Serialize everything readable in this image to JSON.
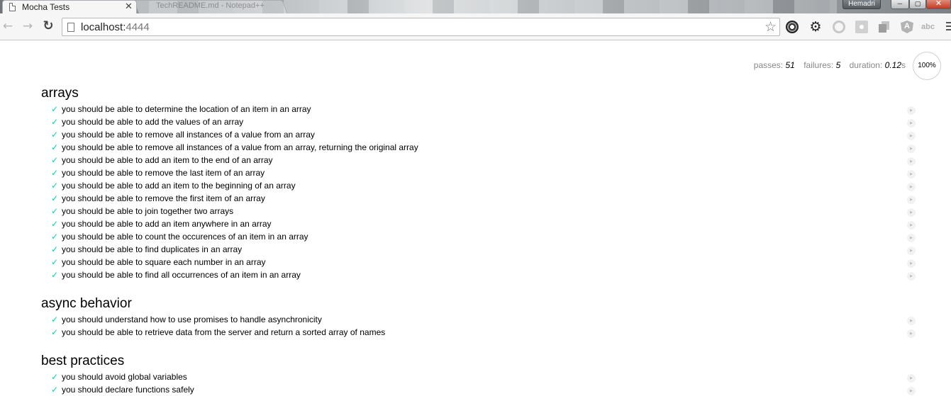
{
  "browser": {
    "active_tab_title": "Mocha Tests",
    "tab_close_glyph": "✕",
    "inactive_tab_text": "TechREADME.md - Notepad++",
    "profile_name": "Hemadri",
    "window_controls": {
      "minimize": "─",
      "maximize": "▢",
      "close": "✕"
    },
    "url_host": "localhost:",
    "url_port": "4444",
    "icons": [
      "back-arrow-icon",
      "forward-arrow-icon",
      "reload-icon",
      "page-icon",
      "bookmark-star-icon",
      "film-reel-icon",
      "gear-icon",
      "circle-extension-icon",
      "square-extension-icon",
      "stack-extension-icon",
      "angular-icon",
      "abc-extension-icon",
      "menu-icon"
    ]
  },
  "stats": {
    "passes_label": "passes:",
    "passes": "51",
    "failures_label": "failures:",
    "failures": "5",
    "duration_label": "duration:",
    "duration": "0.12",
    "duration_unit": "s",
    "progress": "100%"
  },
  "colors": {
    "pass_check": "#00d6b2",
    "stats_label": "#888888"
  },
  "suites": [
    {
      "title": "arrays",
      "tests": [
        "you should be able to determine the location of an item in an array",
        "you should be able to add the values of an array",
        "you should be able to remove all instances of a value from an array",
        "you should be able to remove all instances of a value from an array, returning the original array",
        "you should be able to add an item to the end of an array",
        "you should be able to remove the last item of an array",
        "you should be able to add an item to the beginning of an array",
        "you should be able to remove the first item of an array",
        "you should be able to join together two arrays",
        "you should be able to add an item anywhere in an array",
        "you should be able to count the occurences of an item in an array",
        "you should be able to find duplicates in an array",
        "you should be able to square each number in an array",
        "you should be able to find all occurrences of an item in an array"
      ]
    },
    {
      "title": "async behavior",
      "tests": [
        "you should understand how to use promises to handle asynchronicity",
        "you should be able to retrieve data from the server and return a sorted array of names"
      ]
    },
    {
      "title": "best practices",
      "tests": [
        "you should avoid global variables",
        "you should declare functions safely"
      ]
    }
  ],
  "glyphs": {
    "check": "✓",
    "replay": "▶"
  }
}
